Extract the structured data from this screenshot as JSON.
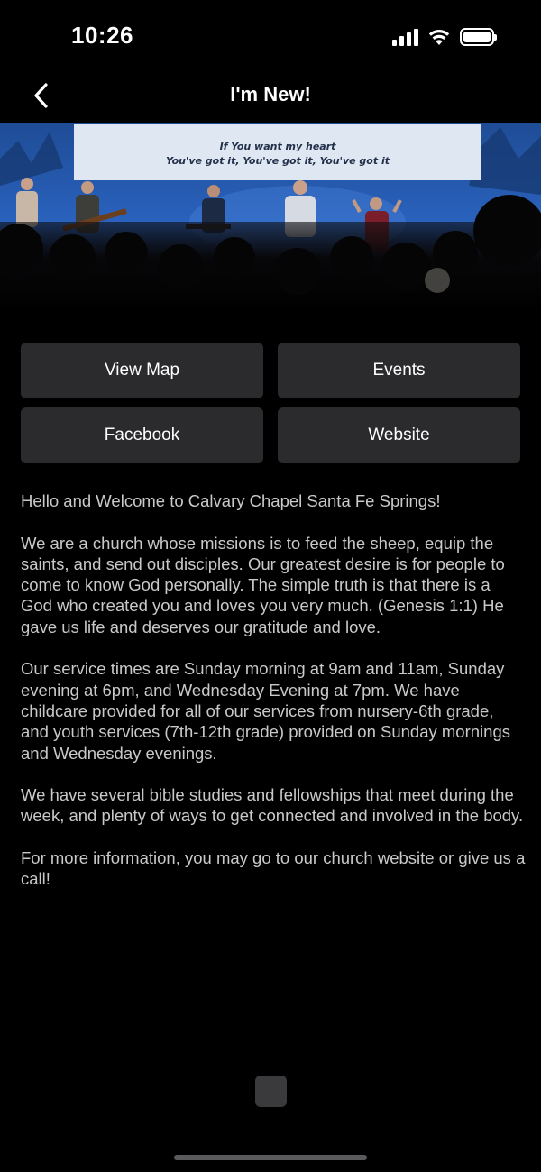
{
  "status_bar": {
    "time": "10:26",
    "icons": [
      "cellular-signal-icon",
      "wifi-icon",
      "battery-icon"
    ]
  },
  "nav": {
    "back_icon": "chevron-left-icon",
    "title": "I'm New!"
  },
  "hero": {
    "description_icon": "worship-band-photo",
    "lyrics_line_1": "If You want my heart",
    "lyrics_line_2": "You've got it, You've got it, You've got it"
  },
  "buttons": {
    "view_map": "View Map",
    "events": "Events",
    "facebook": "Facebook",
    "website": "Website"
  },
  "content": {
    "paragraphs": [
      "Hello and Welcome to Calvary Chapel Santa Fe Springs!",
      "We are a church whose missions is to feed the sheep, equip the saints, and send out disciples. Our greatest desire is for people to come to know God personally. The simple truth is that there is a God who created you and loves you very much. (Genesis 1:1) He gave us life and deserves our gratitude and love.",
      "Our service times are Sunday morning at 9am and 11am, Sunday evening at 6pm, and Wednesday Evening at 7pm. We have childcare provided for all of our services from nursery-6th grade, and youth services (7th-12th grade) provided on Sunday mornings and Wednesday evenings.",
      "We have several bible studies and fellowships that meet during the week, and plenty of ways to get connected and involved in the body.",
      "For more information, you may go to our church website or give us a call!"
    ]
  },
  "colors": {
    "background": "#000000",
    "button_bg": "#2b2b2d",
    "body_text": "#c9c9c9",
    "stage_blue": "#2a5fb8"
  }
}
